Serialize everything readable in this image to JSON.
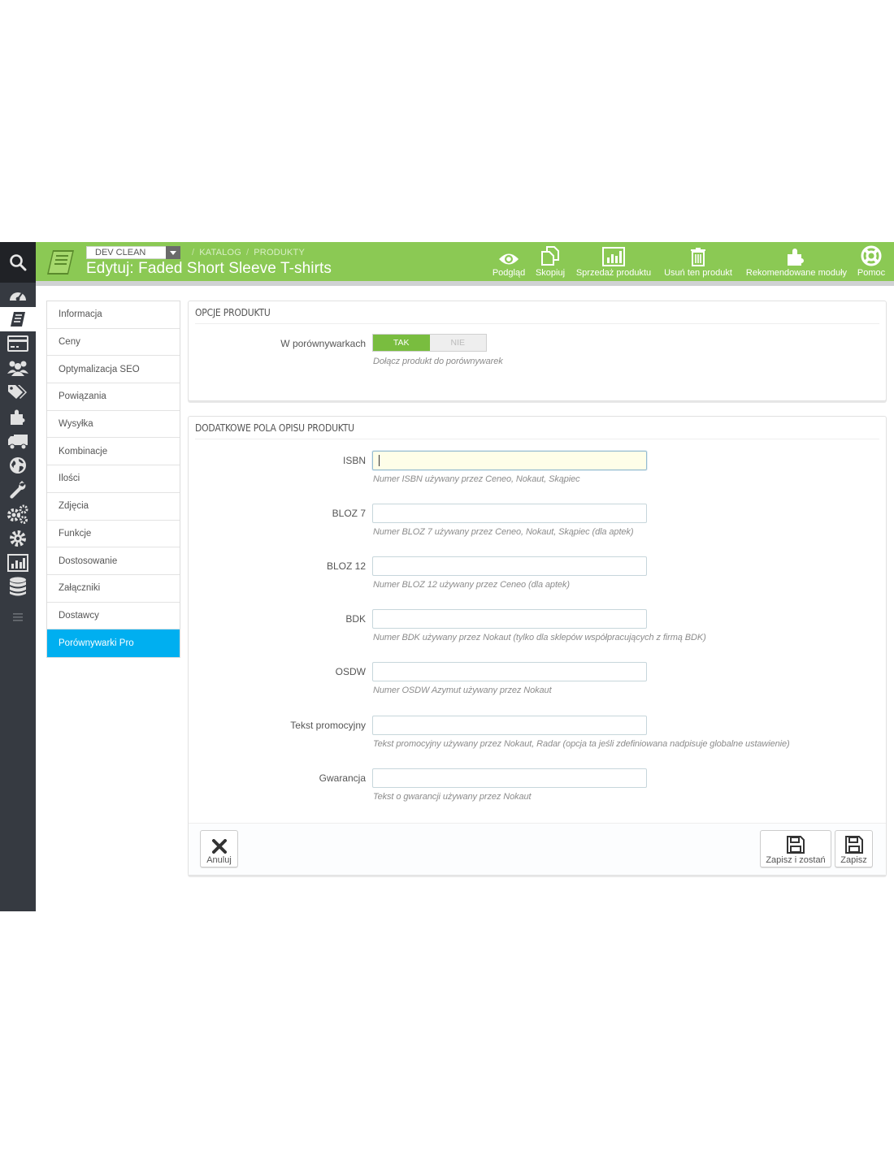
{
  "header": {
    "shop_selector": "DEV CLEAN",
    "breadcrumb": [
      "KATALOG",
      "PRODUKTY"
    ],
    "title": "Edytuj: Faded Short Sleeve T-shirts",
    "toolbar": [
      {
        "label": "Podgląd",
        "icon": "eye-icon"
      },
      {
        "label": "Skopiuj",
        "icon": "copy-icon"
      },
      {
        "label": "Sprzedaż produktu",
        "icon": "bar-chart-icon"
      },
      {
        "label": "Usuń ten produkt",
        "icon": "trash-icon"
      },
      {
        "label": "Rekomendowane moduły",
        "icon": "puzzle-icon"
      },
      {
        "label": "Pomoc",
        "icon": "lifebuoy-icon"
      }
    ]
  },
  "sidebar": {
    "icons": [
      "search-icon",
      "dashboard-icon",
      "catalog-icon",
      "orders-icon",
      "customers-icon",
      "price-rules-icon",
      "modules-icon",
      "shipping-icon",
      "localization-icon",
      "preferences-icon",
      "advanced-parameters-icon",
      "administration-icon",
      "stats-icon",
      "database-icon",
      "collapse-menu-icon"
    ],
    "active_index": 2
  },
  "tabs": [
    {
      "label": "Informacja"
    },
    {
      "label": "Ceny"
    },
    {
      "label": "Optymalizacja SEO"
    },
    {
      "label": "Powiązania"
    },
    {
      "label": "Wysyłka"
    },
    {
      "label": "Kombinacje"
    },
    {
      "label": "Ilości"
    },
    {
      "label": "Zdjęcia"
    },
    {
      "label": "Funkcje"
    },
    {
      "label": "Dostosowanie"
    },
    {
      "label": "Załączniki"
    },
    {
      "label": "Dostawcy"
    },
    {
      "label": "Porównywarki Pro",
      "active": true
    }
  ],
  "panel_options": {
    "heading": "OPCJE PRODUKTU",
    "field_label": "W porównywarkach",
    "switch_on": "TAK",
    "switch_off": "NIE",
    "switch_value": "TAK",
    "help": "Dołącz produkt do porównywarek"
  },
  "panel_fields": {
    "heading": "DODATKOWE POLA OPISU PRODUKTU",
    "fields": [
      {
        "label": "ISBN",
        "value": "",
        "help": "Numer ISBN używany przez Ceneo, Nokaut, Skąpiec",
        "focused": true
      },
      {
        "label": "BLOZ 7",
        "value": "",
        "help": "Numer BLOZ 7 używany przez Ceneo, Nokaut, Skąpiec (dla aptek)"
      },
      {
        "label": "BLOZ 12",
        "value": "",
        "help": "Numer BLOZ 12 używany przez Ceneo (dla aptek)"
      },
      {
        "label": "BDK",
        "value": "",
        "help": "Numer BDK używany przez Nokaut (tylko dla sklepów współpracujących z firmą BDK)"
      },
      {
        "label": "OSDW",
        "value": "",
        "help": "Numer OSDW Azymut używany przez Nokaut"
      },
      {
        "label": "Tekst promocyjny",
        "value": "",
        "help": "Tekst promocyjny używany przez Nokaut, Radar (opcja ta jeśli zdefiniowana nadpisuje globalne ustawienie)"
      },
      {
        "label": "Gwarancja",
        "value": "",
        "help": "Tekst o gwarancji używany przez Nokaut"
      }
    ],
    "footer": {
      "cancel": "Anuluj",
      "save_stay": "Zapisz i zostań",
      "save": "Zapisz"
    }
  },
  "colors": {
    "header": "#8bc954",
    "sidebar": "#363a41",
    "active_tab": "#00aff0",
    "switch_on": "#79bd3f"
  }
}
